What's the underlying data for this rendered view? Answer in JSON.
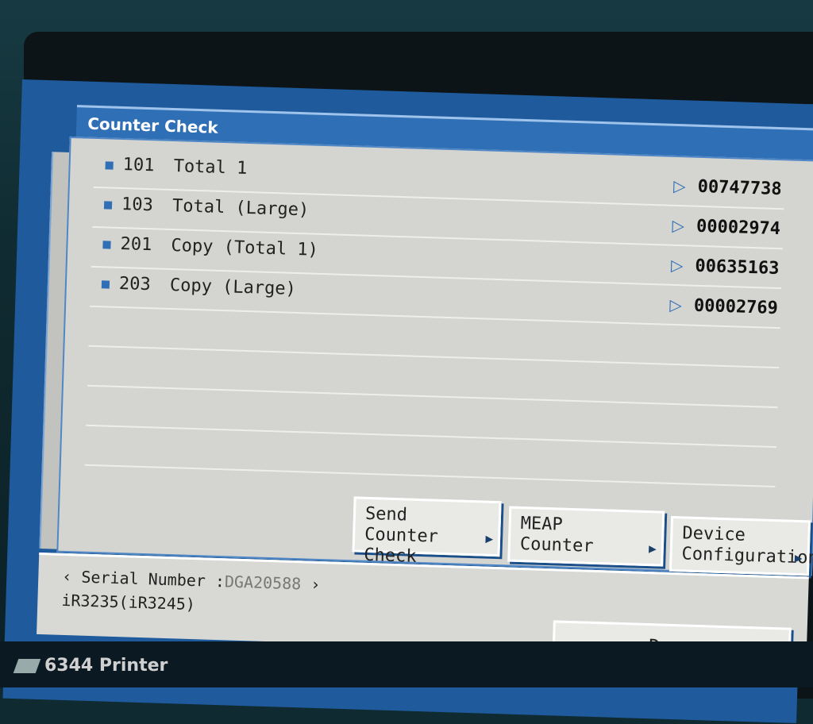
{
  "window": {
    "title": "Counter Check"
  },
  "counters": [
    {
      "code": "101",
      "label": "Total 1",
      "value": "00747738"
    },
    {
      "code": "103",
      "label": "Total (Large)",
      "value": "00002974"
    },
    {
      "code": "201",
      "label": "Copy (Total 1)",
      "value": "00635163"
    },
    {
      "code": "203",
      "label": "Copy (Large)",
      "value": "00002769"
    }
  ],
  "buttons": {
    "send_counter_check": {
      "line1": "Send Counter",
      "line2": "Check"
    },
    "meap_counter": {
      "line1": "MEAP",
      "line2": "Counter"
    },
    "device_configuration": {
      "line1": "Device",
      "line2": "Configuration"
    },
    "done": "Done"
  },
  "footer": {
    "serial_prefix": "‹ Serial Number :",
    "serial_value": "DGA20588",
    "serial_suffix": "›",
    "model": "iR3235(iR3245)"
  },
  "taskbar": {
    "printer_label": "6344 Printer"
  },
  "icons": {
    "bullet": "square-bullet-icon",
    "value_arrow": "triangle-right-icon",
    "submenu": "submenu-arrow-icon",
    "enter": "enter-icon"
  },
  "colors": {
    "accent": "#2f6fb6",
    "panel": "#d4d4d0",
    "frame": "#1e5a9c"
  }
}
